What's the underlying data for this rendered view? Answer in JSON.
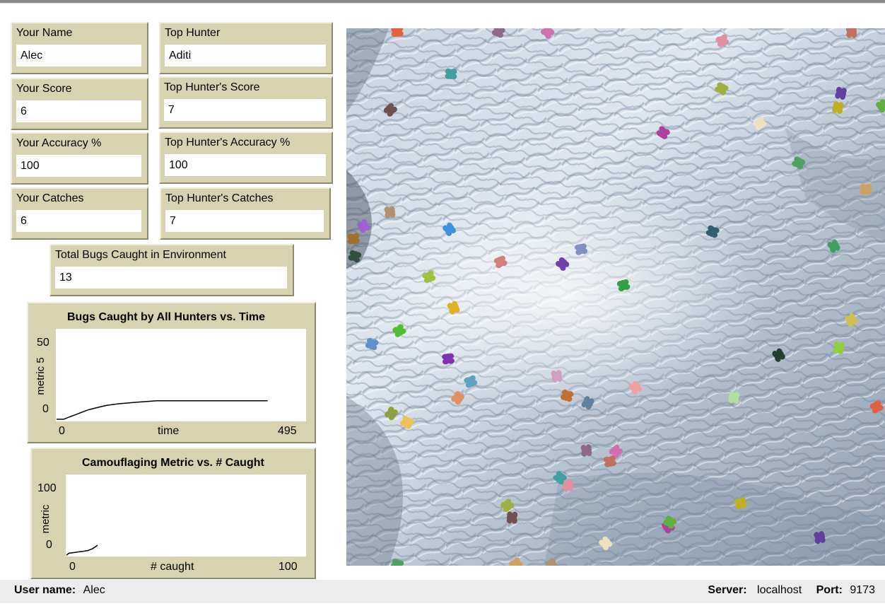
{
  "monitors": {
    "your_name": {
      "label": "Your Name",
      "value": "Alec"
    },
    "top_hunter": {
      "label": "Top Hunter",
      "value": "Aditi"
    },
    "your_score": {
      "label": "Your Score",
      "value": "6"
    },
    "top_score": {
      "label": "Top Hunter's Score",
      "value": "7"
    },
    "your_accuracy": {
      "label": "Your Accuracy %",
      "value": "100"
    },
    "top_accuracy": {
      "label": "Top Hunter's Accuracy %",
      "value": "100"
    },
    "your_catches": {
      "label": "Your Catches",
      "value": "6"
    },
    "top_catches": {
      "label": "Top Hunter's Catches",
      "value": "7"
    },
    "total_bugs": {
      "label": "Total Bugs Caught in Environment",
      "value": "13"
    }
  },
  "chart_data": [
    {
      "type": "line",
      "title": "Bugs Caught by All Hunters vs. Time",
      "xlabel": "time",
      "ylabel": "metric 5",
      "x_tick_labels": [
        "0",
        "495"
      ],
      "y_tick_labels": [
        "50",
        "0"
      ],
      "xlim": [
        0,
        495
      ],
      "ylim": [
        0,
        50
      ],
      "series": [
        {
          "x": [
            0,
            14,
            22,
            30,
            38,
            46,
            54,
            62,
            74,
            86,
            100,
            122,
            158,
            200,
            420
          ],
          "y": [
            -5,
            -5,
            -4,
            -3,
            -2,
            -1,
            0,
            1,
            2,
            3,
            4,
            5,
            6,
            7,
            7
          ]
        }
      ],
      "grid": false
    },
    {
      "type": "line",
      "title": "Camouflaging Metric vs. # Caught",
      "xlabel": "# caught",
      "ylabel": "metric",
      "x_tick_labels": [
        "0",
        "100"
      ],
      "y_tick_labels": [
        "100",
        "0"
      ],
      "xlim": [
        0,
        100
      ],
      "ylim": [
        0,
        100
      ],
      "series": [
        {
          "x": [
            0,
            1,
            3,
            5,
            7,
            9,
            11,
            13
          ],
          "y": [
            -13,
            -10,
            -9,
            -8,
            -7,
            -6,
            -3,
            2
          ]
        }
      ],
      "grid": false
    }
  ],
  "world": {
    "description": "hunting world",
    "bug_colors": [
      "#e06040",
      "#8c6a8a",
      "#d070b0",
      "#c07060",
      "#e090a0",
      "#40a0a0",
      "#a0b040",
      "#705050",
      "#b040a0",
      "#f0e0c0",
      "#6040a0",
      "#c0b020",
      "#60b040",
      "#50a060",
      "#d0a060",
      "#b09070",
      "#a060d0",
      "#4090e0",
      "#306070",
      "#a07030",
      "#40a060",
      "#305040",
      "#d08080",
      "#8090c0",
      "#7040b0",
      "#a0c040",
      "#30a040",
      "#e0b020",
      "#50c030",
      "#6090d0",
      "#d0c050",
      "#90d040",
      "#204030",
      "#8030b0",
      "#60a0c0",
      "#d0a0c0",
      "#c07030",
      "#6080a0",
      "#f0a0a0",
      "#b0e0a0",
      "#e09060",
      "#90a040",
      "#f0c050"
    ]
  },
  "status": {
    "user_label": "User name:",
    "user_value": "Alec",
    "server_label": "Server:",
    "server_value": "localhost",
    "port_label": "Port:",
    "port_value": "9173"
  }
}
